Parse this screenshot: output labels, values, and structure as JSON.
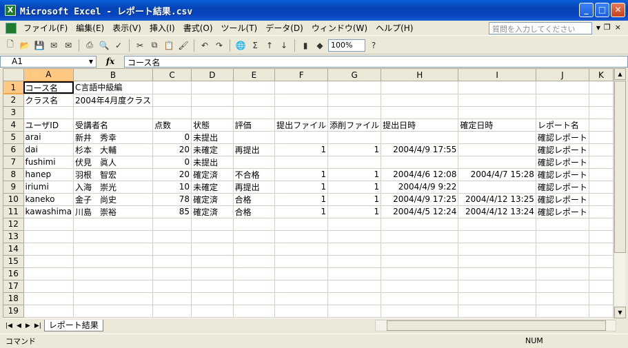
{
  "window": {
    "title": "Microsoft Excel - レポート結果.csv"
  },
  "menu": [
    "ファイル(F)",
    "編集(E)",
    "表示(V)",
    "挿入(I)",
    "書式(O)",
    "ツール(T)",
    "データ(D)",
    "ウィンドウ(W)",
    "ヘルプ(H)"
  ],
  "help_placeholder": "質問を入力してください",
  "toolbar": {
    "zoom": "100%"
  },
  "formula": {
    "name_box": "A1",
    "fx": "fx",
    "value": "コース名"
  },
  "columns": [
    "A",
    "B",
    "C",
    "D",
    "E",
    "F",
    "G",
    "H",
    "I",
    "J",
    "K"
  ],
  "rows": [
    {
      "n": "1",
      "cells": [
        "コース名",
        "C言語中級編",
        "",
        "",
        "",
        "",
        "",
        "",
        "",
        "",
        ""
      ]
    },
    {
      "n": "2",
      "cells": [
        "クラス名",
        "2004年4月度クラス",
        "",
        "",
        "",
        "",
        "",
        "",
        "",
        "",
        ""
      ]
    },
    {
      "n": "3",
      "cells": [
        "",
        "",
        "",
        "",
        "",
        "",
        "",
        "",
        "",
        "",
        ""
      ]
    },
    {
      "n": "4",
      "cells": [
        "ユーザID",
        "受講者名",
        "点数",
        "状態",
        "評価",
        "提出ファイル",
        "添削ファイル",
        "提出日時",
        "確定日時",
        "レポート名",
        ""
      ]
    },
    {
      "n": "5",
      "cells": [
        "arai",
        "新井　秀幸",
        "0",
        "未提出",
        "",
        "",
        "",
        "",
        "",
        "確認レポート",
        ""
      ]
    },
    {
      "n": "6",
      "cells": [
        "dai",
        "杉本　大輔",
        "20",
        "未確定",
        "再提出",
        "1",
        "1",
        "2004/4/9 17:55",
        "",
        "確認レポート",
        ""
      ]
    },
    {
      "n": "7",
      "cells": [
        "fushimi",
        "伏見　眞人",
        "0",
        "未提出",
        "",
        "",
        "",
        "",
        "",
        "確認レポート",
        ""
      ]
    },
    {
      "n": "8",
      "cells": [
        "hanep",
        "羽根　智宏",
        "20",
        "確定済",
        "不合格",
        "1",
        "1",
        "2004/4/6 12:08",
        "2004/4/7 15:28",
        "確認レポート",
        ""
      ]
    },
    {
      "n": "9",
      "cells": [
        "iriumi",
        "入海　崇光",
        "10",
        "未確定",
        "再提出",
        "1",
        "1",
        "2004/4/9 9:22",
        "",
        "確認レポート",
        ""
      ]
    },
    {
      "n": "10",
      "cells": [
        "kaneko",
        "金子　尚史",
        "78",
        "確定済",
        "合格",
        "1",
        "1",
        "2004/4/9 17:25",
        "2004/4/12 13:25",
        "確認レポート",
        ""
      ]
    },
    {
      "n": "11",
      "cells": [
        "kawashima",
        "川島　崇裕",
        "85",
        "確定済",
        "合格",
        "1",
        "1",
        "2004/4/5 12:24",
        "2004/4/12 13:24",
        "確認レポート",
        ""
      ]
    },
    {
      "n": "12",
      "cells": [
        "",
        "",
        "",
        "",
        "",
        "",
        "",
        "",
        "",
        "",
        ""
      ]
    },
    {
      "n": "13",
      "cells": [
        "",
        "",
        "",
        "",
        "",
        "",
        "",
        "",
        "",
        "",
        ""
      ]
    },
    {
      "n": "14",
      "cells": [
        "",
        "",
        "",
        "",
        "",
        "",
        "",
        "",
        "",
        "",
        ""
      ]
    },
    {
      "n": "15",
      "cells": [
        "",
        "",
        "",
        "",
        "",
        "",
        "",
        "",
        "",
        "",
        ""
      ]
    },
    {
      "n": "16",
      "cells": [
        "",
        "",
        "",
        "",
        "",
        "",
        "",
        "",
        "",
        "",
        ""
      ]
    },
    {
      "n": "17",
      "cells": [
        "",
        "",
        "",
        "",
        "",
        "",
        "",
        "",
        "",
        "",
        ""
      ]
    },
    {
      "n": "18",
      "cells": [
        "",
        "",
        "",
        "",
        "",
        "",
        "",
        "",
        "",
        "",
        ""
      ]
    },
    {
      "n": "19",
      "cells": [
        "",
        "",
        "",
        "",
        "",
        "",
        "",
        "",
        "",
        "",
        ""
      ]
    }
  ],
  "numeric_columns": [
    2,
    5,
    6,
    7,
    8
  ],
  "sheet_tab": "レポート結果",
  "status": {
    "mode": "コマンド",
    "num": "NUM"
  }
}
